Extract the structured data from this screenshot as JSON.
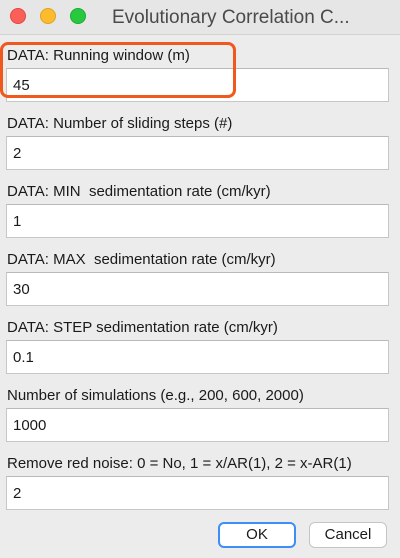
{
  "window": {
    "title": "Evolutionary Correlation C..."
  },
  "fields": [
    {
      "label": "DATA: Running window (m)",
      "value": "45"
    },
    {
      "label": "DATA: Number of sliding steps (#)",
      "value": "2"
    },
    {
      "label": "DATA: MIN  sedimentation rate (cm/kyr)",
      "value": "1"
    },
    {
      "label": "DATA: MAX  sedimentation rate (cm/kyr)",
      "value": "30"
    },
    {
      "label": "DATA: STEP sedimentation rate (cm/kyr)",
      "value": "0.1"
    },
    {
      "label": "Number of simulations (e.g., 200, 600, 2000)",
      "value": "1000"
    },
    {
      "label": "Remove red noise: 0 = No, 1 = x/AR(1), 2 = x-AR(1)",
      "value": "2"
    }
  ],
  "buttons": {
    "ok_label": "OK",
    "cancel_label": "Cancel"
  },
  "colors": {
    "focus_ring": "#f0581d",
    "default_button_border": "#3d8ef7",
    "close": "#fc5f57",
    "minimize": "#fdbc2e",
    "maximize": "#28c840"
  }
}
